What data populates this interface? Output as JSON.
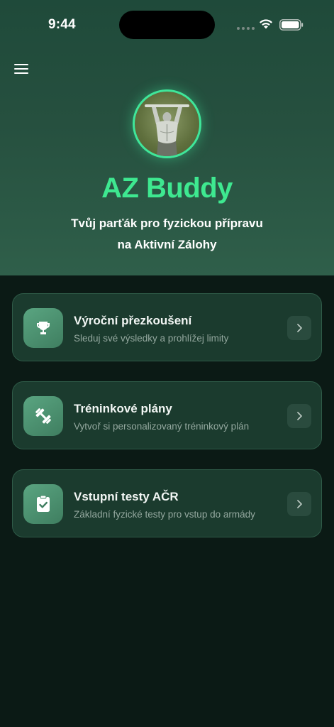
{
  "status_bar": {
    "time": "9:44"
  },
  "header": {
    "app_title": "AZ Buddy",
    "tagline_line1": "Tvůj parťák pro fyzickou přípravu",
    "tagline_line2": "na Aktivní Zálohy"
  },
  "cards": [
    {
      "title": "Výroční přezkoušení",
      "subtitle": "Sleduj své výsledky a prohlížej limity",
      "icon": "trophy-icon"
    },
    {
      "title": "Tréninkové plány",
      "subtitle": "Vytvoř si personalizovaný tréninkový plán",
      "icon": "dumbbell-icon"
    },
    {
      "title": "Vstupní testy AČR",
      "subtitle": "Základní fyzické testy pro vstup do armády",
      "icon": "clipboard-check-icon"
    }
  ],
  "colors": {
    "accent": "#3ee890",
    "header_bg": "#26503f",
    "page_bg": "#0b1a15",
    "card_bg": "#1b3b2e"
  }
}
